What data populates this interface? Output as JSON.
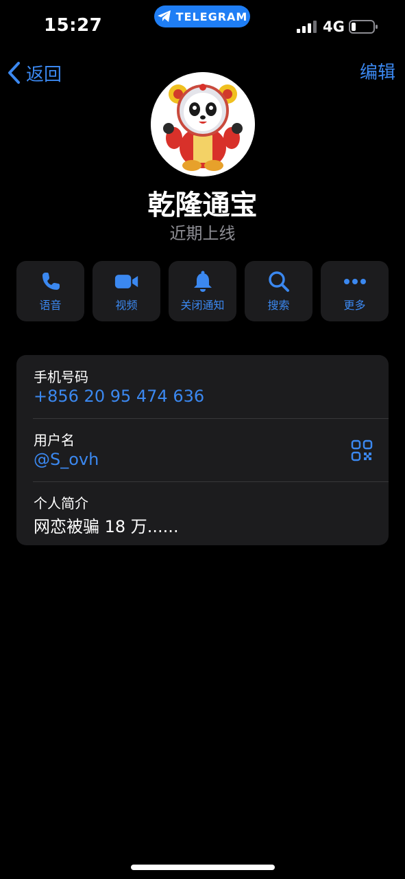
{
  "status_bar": {
    "time": "15:27",
    "app_pill": "TELEGRAM",
    "network": "4G"
  },
  "nav": {
    "back_label": "返回",
    "edit_label": "编辑"
  },
  "profile": {
    "name": "乾隆通宝",
    "status": "近期上线"
  },
  "actions": [
    {
      "label": "语音",
      "icon": "phone-icon"
    },
    {
      "label": "视频",
      "icon": "video-camera-icon"
    },
    {
      "label": "关闭通知",
      "icon": "bell-icon"
    },
    {
      "label": "搜索",
      "icon": "search-icon"
    },
    {
      "label": "更多",
      "icon": "more-dots-icon"
    }
  ],
  "info": {
    "phone_label": "手机号码",
    "phone_value": "+856 20 95 474 636",
    "username_label": "用户名",
    "username_value": "@S_ovh",
    "bio_label": "个人简介",
    "bio_value": "网恋被骗 18 万......"
  },
  "colors": {
    "accent": "#3b88f0",
    "background": "#000000",
    "card": "#1c1c1e",
    "secondary_text": "#8d8d93",
    "pill": "#1f7ef5"
  }
}
